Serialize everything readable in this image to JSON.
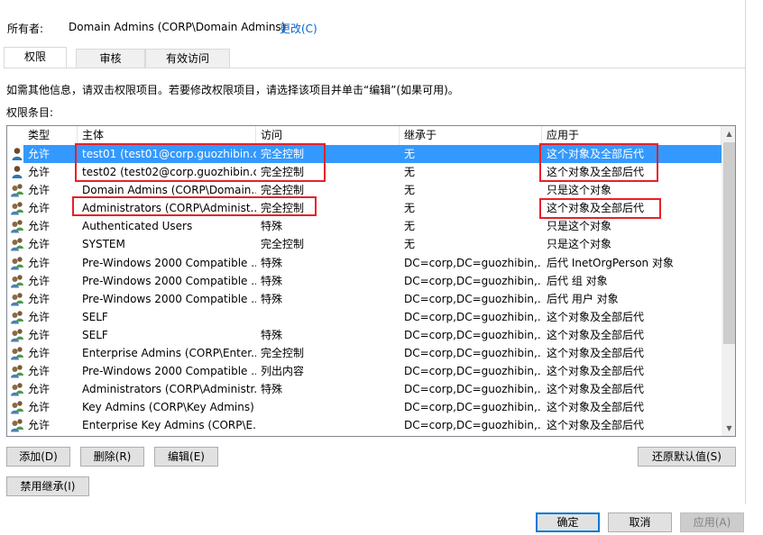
{
  "owner": {
    "label": "所有者:",
    "value": "Domain Admins (CORP\\Domain Admins)",
    "change_link": "更改(C)"
  },
  "tabs": [
    {
      "label": "权限",
      "active": true
    },
    {
      "label": "审核",
      "active": false
    },
    {
      "label": "有效访问",
      "active": false
    }
  ],
  "info_text": "如需其他信息，请双击权限项目。若要修改权限项目，请选择该项目并单击“编辑”(如果可用)。",
  "entries_label": "权限条目:",
  "columns": [
    "类型",
    "主体",
    "访问",
    "继承于",
    "应用于"
  ],
  "rows": [
    {
      "icon": "user-icon",
      "type": "允许",
      "principal": "test01 (test01@corp.guozhibin.c...",
      "access": "完全控制",
      "inherited": "无",
      "applies": "这个对象及全部后代",
      "selected": true
    },
    {
      "icon": "user-icon",
      "type": "允许",
      "principal": "test02 (test02@corp.guozhibin.c...",
      "access": "完全控制",
      "inherited": "无",
      "applies": "这个对象及全部后代"
    },
    {
      "icon": "group-icon",
      "type": "允许",
      "principal": "Domain Admins (CORP\\Domain...",
      "access": "完全控制",
      "inherited": "无",
      "applies": "只是这个对象"
    },
    {
      "icon": "group-icon",
      "type": "允许",
      "principal": "Administrators (CORP\\Administ...",
      "access": "完全控制",
      "inherited": "无",
      "applies": "这个对象及全部后代"
    },
    {
      "icon": "group-icon",
      "type": "允许",
      "principal": "Authenticated Users",
      "access": "特殊",
      "inherited": "无",
      "applies": "只是这个对象"
    },
    {
      "icon": "group-icon",
      "type": "允许",
      "principal": "SYSTEM",
      "access": "完全控制",
      "inherited": "无",
      "applies": "只是这个对象"
    },
    {
      "icon": "group-icon",
      "type": "允许",
      "principal": "Pre-Windows 2000 Compatible ...",
      "access": "特殊",
      "inherited": "DC=corp,DC=guozhibin,...",
      "applies": "后代 InetOrgPerson 对象"
    },
    {
      "icon": "group-icon",
      "type": "允许",
      "principal": "Pre-Windows 2000 Compatible ...",
      "access": "特殊",
      "inherited": "DC=corp,DC=guozhibin,...",
      "applies": "后代 组 对象"
    },
    {
      "icon": "group-icon",
      "type": "允许",
      "principal": "Pre-Windows 2000 Compatible ...",
      "access": "特殊",
      "inherited": "DC=corp,DC=guozhibin,...",
      "applies": "后代 用户 对象"
    },
    {
      "icon": "group-icon",
      "type": "允许",
      "principal": "SELF",
      "access": "",
      "inherited": "DC=corp,DC=guozhibin,...",
      "applies": "这个对象及全部后代"
    },
    {
      "icon": "group-icon",
      "type": "允许",
      "principal": "SELF",
      "access": "特殊",
      "inherited": "DC=corp,DC=guozhibin,...",
      "applies": "这个对象及全部后代"
    },
    {
      "icon": "group-icon",
      "type": "允许",
      "principal": "Enterprise Admins (CORP\\Enter...",
      "access": "完全控制",
      "inherited": "DC=corp,DC=guozhibin,...",
      "applies": "这个对象及全部后代"
    },
    {
      "icon": "group-icon",
      "type": "允许",
      "principal": "Pre-Windows 2000 Compatible ...",
      "access": "列出内容",
      "inherited": "DC=corp,DC=guozhibin,...",
      "applies": "这个对象及全部后代"
    },
    {
      "icon": "group-icon",
      "type": "允许",
      "principal": "Administrators (CORP\\Administr...",
      "access": "特殊",
      "inherited": "DC=corp,DC=guozhibin,...",
      "applies": "这个对象及全部后代"
    },
    {
      "icon": "group-icon",
      "type": "允许",
      "principal": "Key Admins (CORP\\Key Admins)",
      "access": "",
      "inherited": "DC=corp,DC=guozhibin,...",
      "applies": "这个对象及全部后代"
    },
    {
      "icon": "group-icon",
      "type": "允许",
      "principal": "Enterprise Key Admins (CORP\\E...",
      "access": "",
      "inherited": "DC=corp,DC=guozhibin,...",
      "applies": "这个对象及全部后代"
    }
  ],
  "buttons": {
    "add": "添加(D)",
    "remove": "删除(R)",
    "edit": "编辑(E)",
    "restore_defaults": "还原默认值(S)",
    "disable_inheritance": "禁用继承(I)",
    "ok": "确定",
    "cancel": "取消",
    "apply": "应用(A)"
  },
  "colors": {
    "selection": "#3399ff",
    "highlight_box": "#e8202a",
    "link": "#0066cc",
    "primary_border": "#0078d7"
  }
}
